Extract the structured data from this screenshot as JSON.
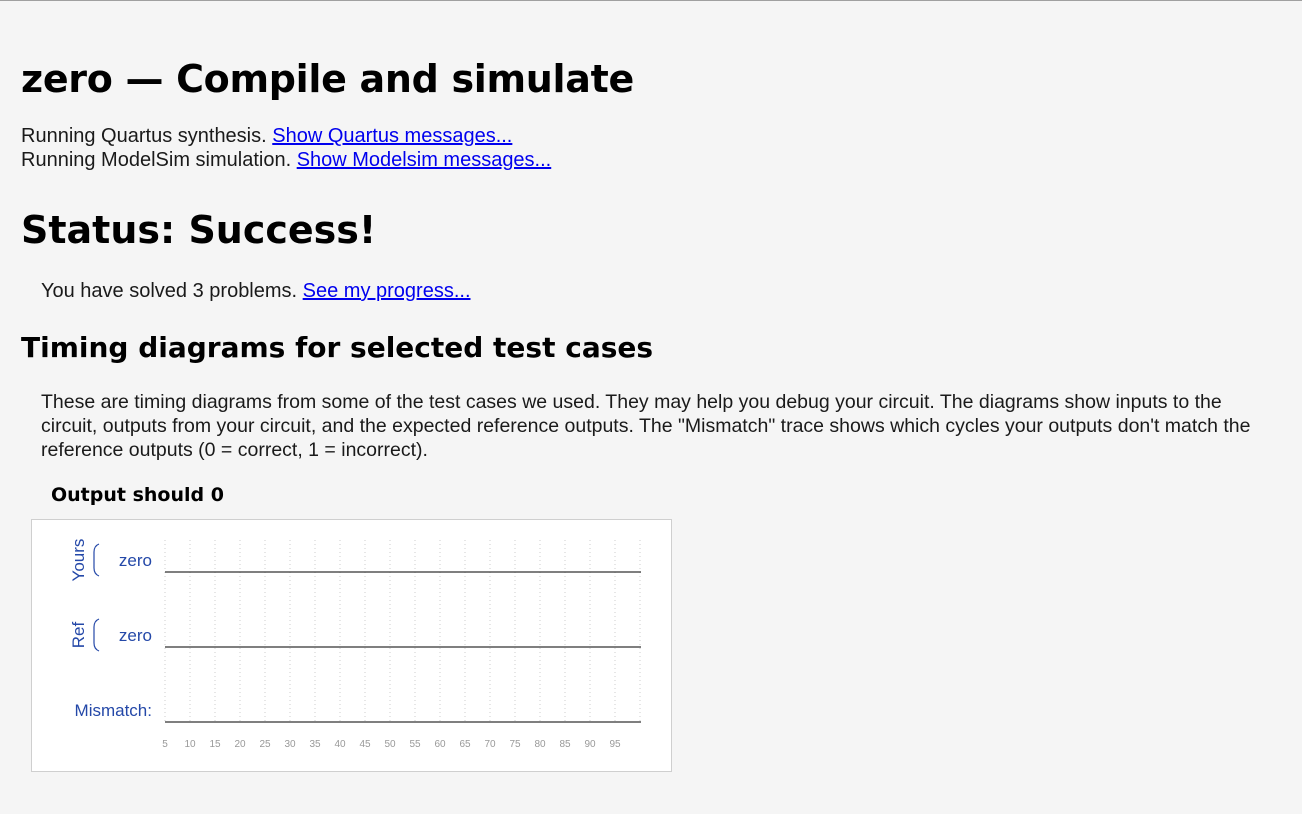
{
  "page": {
    "title": "zero — Compile and simulate"
  },
  "status_lines": {
    "quartus_text": "Running Quartus synthesis. ",
    "quartus_link": "Show Quartus messages...",
    "modelsim_text": "Running ModelSim simulation. ",
    "modelsim_link": "Show Modelsim messages..."
  },
  "status": {
    "heading": "Status: Success!"
  },
  "progress": {
    "text": "You have solved 3 problems. ",
    "link": "See my progress..."
  },
  "timing": {
    "heading": "Timing diagrams for selected test cases",
    "description": "These are timing diagrams from some of the test cases we used. They may help you debug your circuit. The diagrams show inputs to the circuit, outputs from your circuit, and the expected reference outputs. The \"Mismatch\" trace shows which cycles your outputs don't match the reference outputs (0 = correct, 1 = incorrect).",
    "diagram_title": "Output should 0"
  },
  "waveform": {
    "groups": {
      "yours": "Yours",
      "ref": "Ref"
    },
    "signals": [
      {
        "group": "yours",
        "name": "zero",
        "level": 0
      },
      {
        "group": "ref",
        "name": "zero",
        "level": 0
      },
      {
        "group": null,
        "name": "Mismatch:",
        "level": 0
      }
    ],
    "ticks": [
      "5",
      "10",
      "15",
      "20",
      "25",
      "30",
      "35",
      "40",
      "45",
      "50",
      "55",
      "60",
      "65",
      "70",
      "75",
      "80",
      "85",
      "90",
      "95"
    ],
    "colors": {
      "label": "#2448a8",
      "trace": "#333333",
      "grid": "#cccccc",
      "tick": "#999999"
    }
  }
}
